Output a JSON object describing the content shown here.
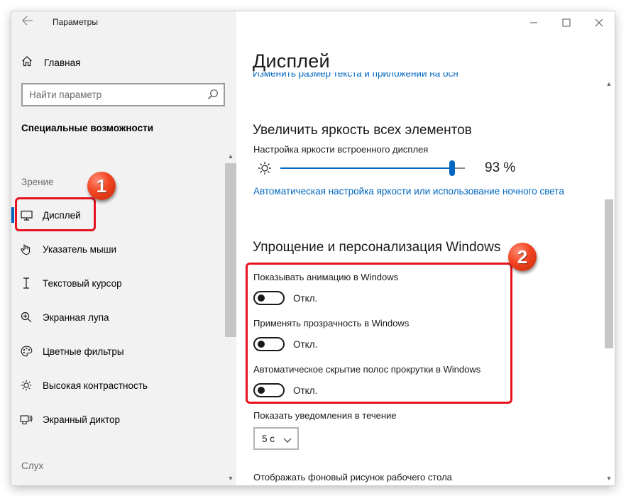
{
  "window": {
    "title": "Параметры",
    "controls": {
      "minimize": "minimize-icon",
      "maximize": "maximize-icon",
      "close": "close-icon"
    }
  },
  "sidebar": {
    "back_icon": "back-arrow-icon",
    "home": {
      "icon": "home-icon",
      "label": "Главная"
    },
    "search": {
      "placeholder": "Найти параметр",
      "icon": "search-icon"
    },
    "section_title": "Специальные возможности",
    "groups": [
      {
        "label": "Зрение"
      },
      {
        "label": "Слух"
      }
    ],
    "items": [
      {
        "icon": "monitor-icon",
        "label": "Дисплей",
        "active": true
      },
      {
        "icon": "mouse-pointer-icon",
        "label": "Указатель мыши"
      },
      {
        "icon": "text-cursor-icon",
        "label": "Текстовый курсор"
      },
      {
        "icon": "magnifier-icon",
        "label": "Экранная лупа"
      },
      {
        "icon": "palette-icon",
        "label": "Цветные фильтры"
      },
      {
        "icon": "brightness-icon",
        "label": "Высокая контрастность"
      },
      {
        "icon": "narrator-icon",
        "label": "Экранный диктор"
      }
    ]
  },
  "main": {
    "page_title": "Дисплей",
    "cut_link": "Изменить размер текста и приложений на основном дисплее",
    "brightness": {
      "heading": "Увеличить яркость всех элементов",
      "slider_label": "Настройка яркости встроенного дисплея",
      "value_text": "93 %",
      "value": 93,
      "link": "Автоматическая настройка яркости или использование ночного света"
    },
    "personalization": {
      "heading": "Упрощение и персонализация Windows",
      "toggles": [
        {
          "label": "Показывать анимацию в Windows",
          "state": "Откл."
        },
        {
          "label": "Применять прозрачность в Windows",
          "state": "Откл."
        },
        {
          "label": "Автоматическое скрытие полос прокрутки в Windows",
          "state": "Откл."
        }
      ],
      "notifications_label": "Показать уведомления в течение",
      "notifications_value": "5 с",
      "background_label": "Отображать фоновый рисунок рабочего стола"
    }
  },
  "annotations": {
    "badge1": "1",
    "badge2": "2",
    "color": "#e8121f"
  },
  "colors": {
    "accent": "#0067c0",
    "sidebar_bg": "#f2f2f2"
  }
}
